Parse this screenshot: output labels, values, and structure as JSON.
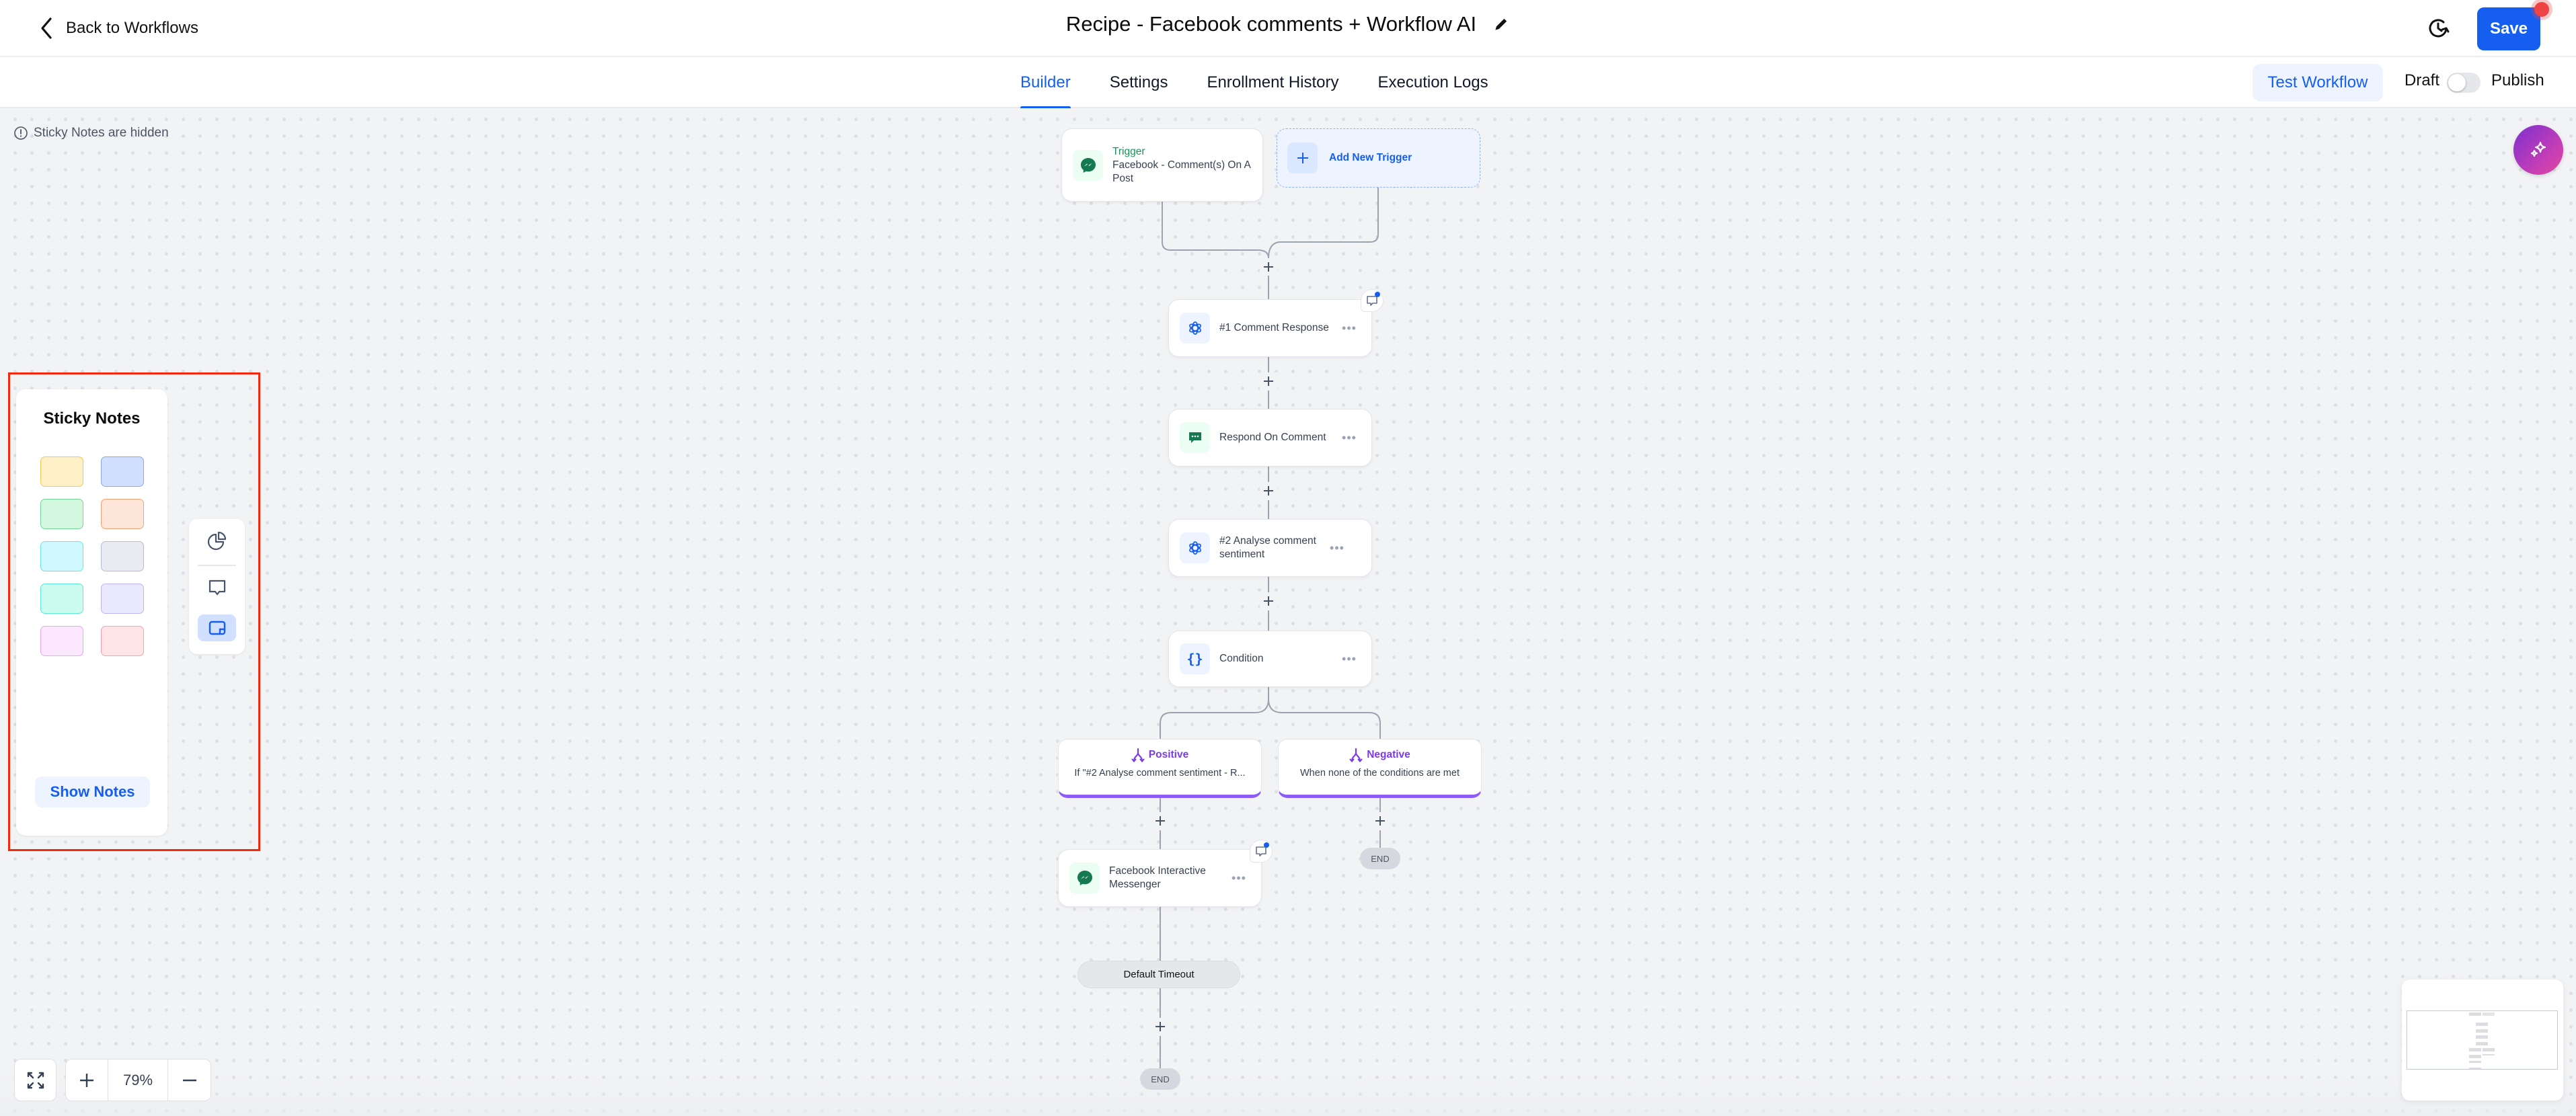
{
  "header": {
    "back_label": "Back to Workflows",
    "title": "Recipe - Facebook comments + Workflow AI",
    "save_label": "Save"
  },
  "subnav": {
    "tabs": [
      {
        "label": "Builder",
        "active": true
      },
      {
        "label": "Settings",
        "active": false
      },
      {
        "label": "Enrollment History",
        "active": false
      },
      {
        "label": "Execution Logs",
        "active": false
      }
    ],
    "test_label": "Test Workflow",
    "draft_label": "Draft",
    "publish_label": "Publish",
    "published": false
  },
  "canvas": {
    "sticky_hidden_notice": "Sticky Notes are hidden",
    "trigger": {
      "heading": "Trigger",
      "name": "Facebook - Comment(s) On A Post",
      "icon": "messenger-icon"
    },
    "add_trigger_label": "Add New Trigger",
    "actions": [
      {
        "label": "#1 Comment Response",
        "icon": "openai-icon",
        "has_note": true
      },
      {
        "label": "Respond On Comment",
        "icon": "comment-reply-icon",
        "has_note": false
      },
      {
        "label": "#2 Analyse comment sentiment",
        "icon": "openai-icon",
        "has_note": false
      },
      {
        "label": "Condition",
        "icon": "curly-braces-icon",
        "has_note": false
      }
    ],
    "branches": [
      {
        "title": "Positive",
        "description": "If \"#2 Analyse comment sentiment - R..."
      },
      {
        "title": "Negative",
        "description": "When none of the conditions are met"
      }
    ],
    "positive_action": {
      "label": "Facebook Interactive Messenger",
      "icon": "messenger-icon",
      "has_note": true
    },
    "timeout_label": "Default Timeout",
    "end_label": "END"
  },
  "sticky_panel": {
    "title": "Sticky Notes",
    "swatches": [
      {
        "name": "yellow",
        "fill": "#fef0c7",
        "border": "#f9c74f"
      },
      {
        "name": "blue",
        "fill": "#d1e0ff",
        "border": "#84a9f5"
      },
      {
        "name": "green",
        "fill": "#d3f8df",
        "border": "#73d69a"
      },
      {
        "name": "orange",
        "fill": "#fde6d8",
        "border": "#f7a072"
      },
      {
        "name": "cyan",
        "fill": "#cff9fe",
        "border": "#67e3f9"
      },
      {
        "name": "gray",
        "fill": "#e9ebf3",
        "border": "#b7bcd6"
      },
      {
        "name": "teal",
        "fill": "#ccfbef",
        "border": "#5eead4"
      },
      {
        "name": "lavender",
        "fill": "#ebe9fe",
        "border": "#bdb4fe"
      },
      {
        "name": "pink",
        "fill": "#fbe8ff",
        "border": "#eaa5f7"
      },
      {
        "name": "rose",
        "fill": "#ffe4e8",
        "border": "#f8a0b0"
      }
    ],
    "show_notes_label": "Show Notes"
  },
  "tools": [
    {
      "name": "analytics-tool",
      "icon": "pie-chart-icon",
      "active": false
    },
    {
      "name": "comment-tool",
      "icon": "comment-icon",
      "active": false
    },
    {
      "name": "sticky-note-tool",
      "icon": "sticky-note-icon",
      "active": true
    }
  ],
  "zoom": {
    "level": "79%"
  },
  "colors": {
    "primary": "#155eef",
    "trigger_green": "#16945a",
    "branch_purple": "#7c3aed",
    "highlight_red": "#f0290f"
  }
}
